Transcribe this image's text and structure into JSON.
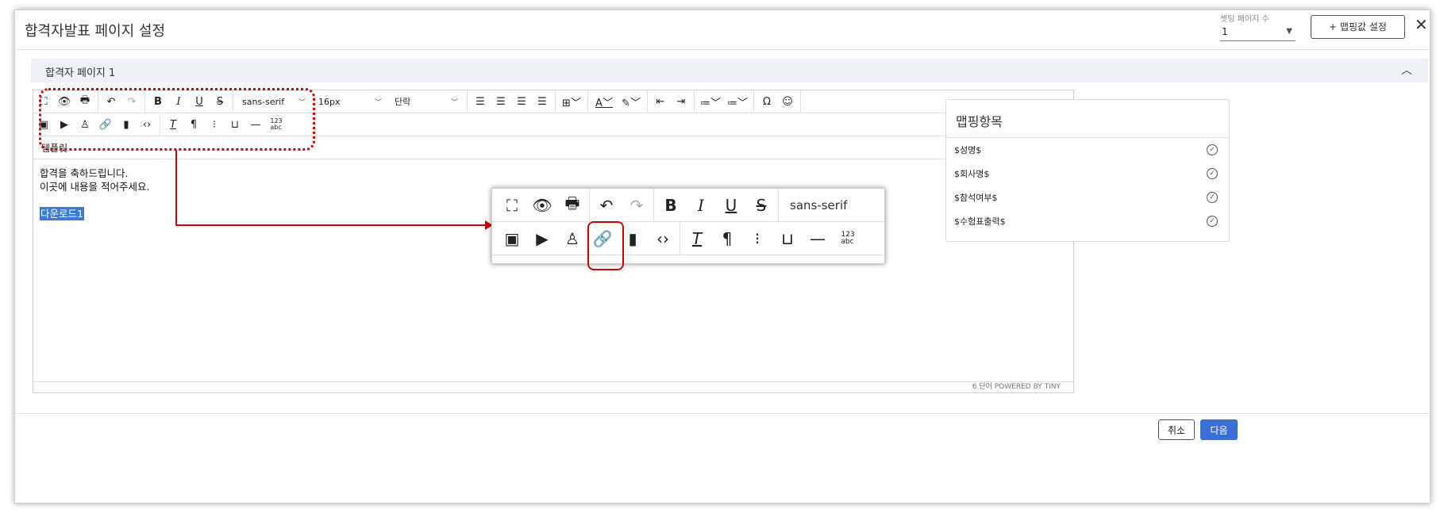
{
  "dialog": {
    "title": "합격자발표 페이지 설정",
    "close_label": "✕"
  },
  "setting_count": {
    "label": "셋팅 페이지 수",
    "value": "1"
  },
  "mapping_button": {
    "label": "+ 맵핑값 설정"
  },
  "section": {
    "title": "합격자 페이지 1"
  },
  "toolbar": {
    "font_family": "sans-serif",
    "font_size": "16px",
    "block_format": "단락"
  },
  "editor": {
    "menu": "템플릿",
    "line1": "합격을 축하드립니다.",
    "line2": "이곳에 내용을 적어주세요.",
    "selected_text": "다운로드1",
    "status": "6 단어  POWERED BY TINY"
  },
  "zoom": {
    "font_family": "sans-serif"
  },
  "mapping_panel": {
    "title": "맵핑항목",
    "items": [
      "$성명$",
      "$회사명$",
      "$참석여부$",
      "$수험표출력$"
    ]
  },
  "footer": {
    "cancel_label": "취소",
    "next_label": "다음"
  },
  "colors": {
    "accent": "#3b6fd6",
    "highlight": "#d80000",
    "selection": "#3a7bd5"
  }
}
